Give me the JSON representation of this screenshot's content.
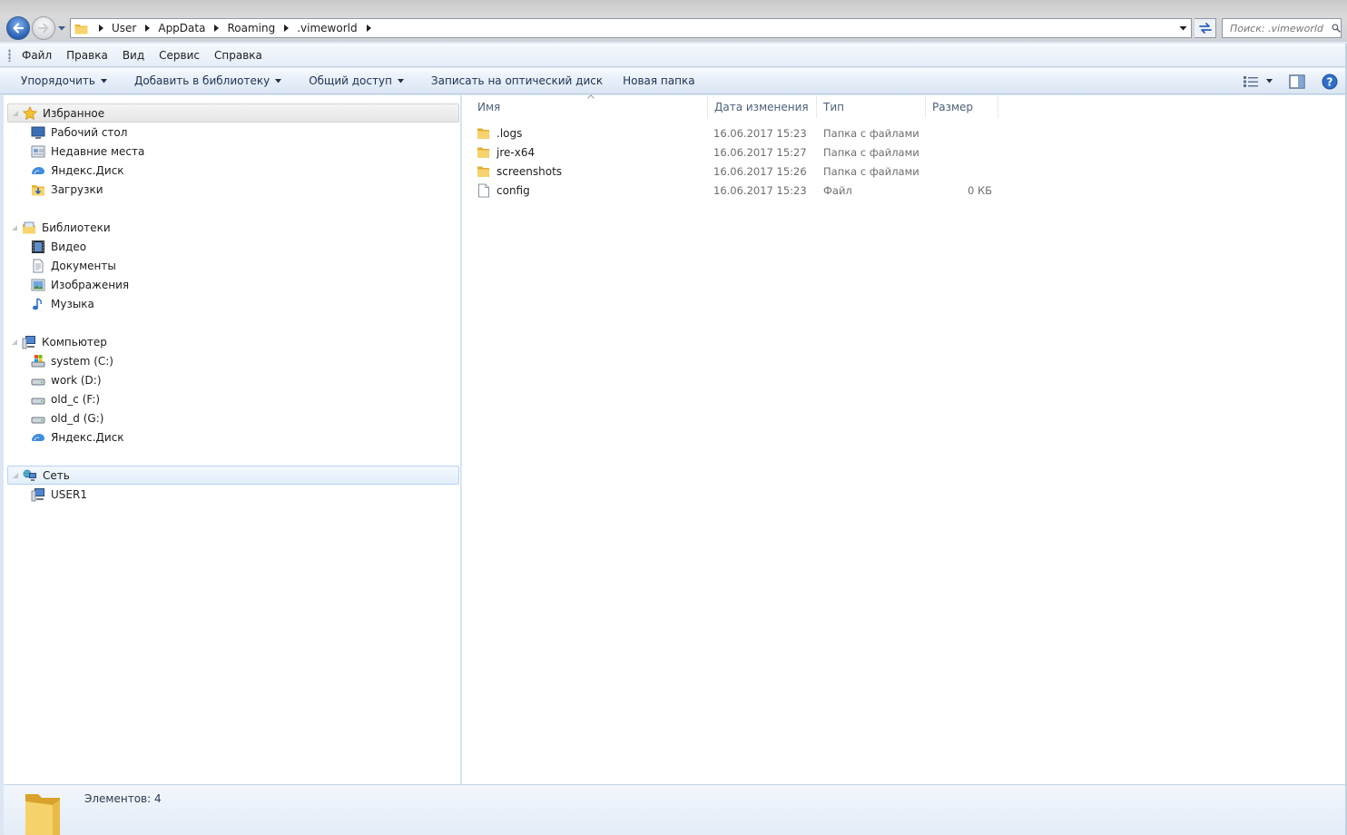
{
  "address": {
    "crumbs": [
      "User",
      "AppData",
      "Roaming",
      ".vimeworld"
    ],
    "search_placeholder": "Поиск: .vimeworld"
  },
  "menu": [
    "Файл",
    "Правка",
    "Вид",
    "Сервис",
    "Справка"
  ],
  "commands": {
    "organize": "Упорядочить",
    "add_library": "Добавить в библиотеку",
    "share": "Общий доступ",
    "burn": "Записать на оптический диск",
    "new_folder": "Новая папка"
  },
  "nav": {
    "favorites": {
      "label": "Избранное",
      "items": [
        "Рабочий стол",
        "Недавние места",
        "Яндекс.Диск",
        "Загрузки"
      ]
    },
    "libraries": {
      "label": "Библиотеки",
      "items": [
        "Видео",
        "Документы",
        "Изображения",
        "Музыка"
      ]
    },
    "computer": {
      "label": "Компьютер",
      "items": [
        "system (C:)",
        "work (D:)",
        "old_c (F:)",
        "old_d (G:)",
        "Яндекс.Диск"
      ]
    },
    "network": {
      "label": "Сеть",
      "items": [
        "USER1"
      ]
    }
  },
  "columns": {
    "name": "Имя",
    "date": "Дата изменения",
    "type": "Тип",
    "size": "Размер"
  },
  "files": [
    {
      "name": ".logs",
      "date": "16.06.2017 15:23",
      "type": "Папка с файлами",
      "size": "",
      "icon": "folder-icon"
    },
    {
      "name": "jre-x64",
      "date": "16.06.2017 15:27",
      "type": "Папка с файлами",
      "size": "",
      "icon": "folder-icon"
    },
    {
      "name": "screenshots",
      "date": "16.06.2017 15:26",
      "type": "Папка с файлами",
      "size": "",
      "icon": "folder-icon"
    },
    {
      "name": "config",
      "date": "16.06.2017 15:23",
      "type": "Файл",
      "size": "0 КБ",
      "icon": "file-icon"
    }
  ],
  "status": {
    "items_count": "Элементов: 4"
  },
  "colors": {
    "accent": "#2a61b7",
    "folder": "#f2cc58",
    "selection_border": "#b9d3ee"
  }
}
